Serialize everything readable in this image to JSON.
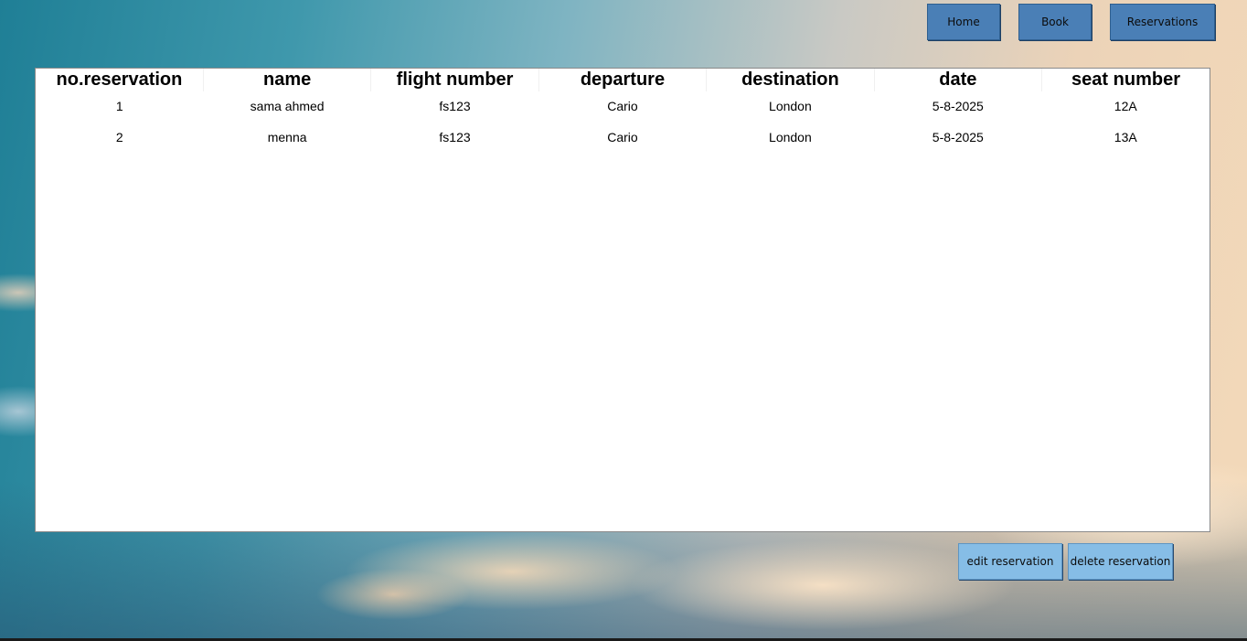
{
  "nav": {
    "home_label": "Home",
    "book_label": "Book",
    "reservations_label": "Reservations"
  },
  "table": {
    "columns": [
      "no.reservation",
      "name",
      "flight number",
      "departure",
      "destination",
      "date",
      "seat number"
    ],
    "rows": [
      [
        "1",
        "sama ahmed",
        "fs123",
        "Cario",
        "London",
        "5-8-2025",
        "12A"
      ],
      [
        "2",
        "menna",
        "fs123",
        "Cario",
        "London",
        "5-8-2025",
        "13A"
      ]
    ]
  },
  "actions": {
    "edit_label": "edit reservation",
    "delete_label": "delete reservation"
  },
  "colors": {
    "nav_button": "#4a7fb6",
    "action_button": "#86bde6"
  }
}
